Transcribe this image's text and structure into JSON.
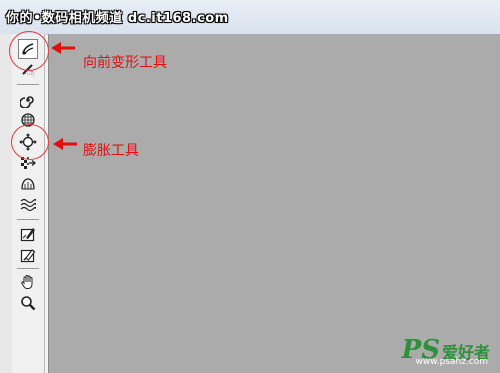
{
  "watermark_top": "你的•数码相机频道 dc.it168.com",
  "annotations": {
    "forward_warp": "向前变形工具",
    "bloat": "膨胀工具"
  },
  "toolbar": {
    "tools": [
      {
        "name": "forward-warp-tool",
        "icon": "forward-warp-icon",
        "selected": true
      },
      {
        "name": "reconstruct-tool",
        "icon": "reconstruct-icon"
      },
      {
        "name": "twirl-clockwise-tool",
        "icon": "twirl-icon"
      },
      {
        "name": "pucker-tool",
        "icon": "pucker-icon"
      },
      {
        "name": "bloat-tool",
        "icon": "bloat-icon"
      },
      {
        "name": "push-left-tool",
        "icon": "push-left-icon"
      },
      {
        "name": "mirror-tool",
        "icon": "mirror-icon"
      },
      {
        "name": "turbulence-tool",
        "icon": "turbulence-icon"
      },
      {
        "name": "freeze-mask-tool",
        "icon": "freeze-mask-icon"
      },
      {
        "name": "thaw-mask-tool",
        "icon": "thaw-mask-icon"
      },
      {
        "name": "hand-tool",
        "icon": "hand-icon"
      },
      {
        "name": "zoom-tool",
        "icon": "zoom-icon"
      }
    ]
  },
  "logo": {
    "ps": "PS",
    "cn": "爱好者",
    "url": "www.psahz.com"
  },
  "colors": {
    "canvas": "#ababab",
    "annotation": "#e01010",
    "logo": "#2f8f3a"
  }
}
